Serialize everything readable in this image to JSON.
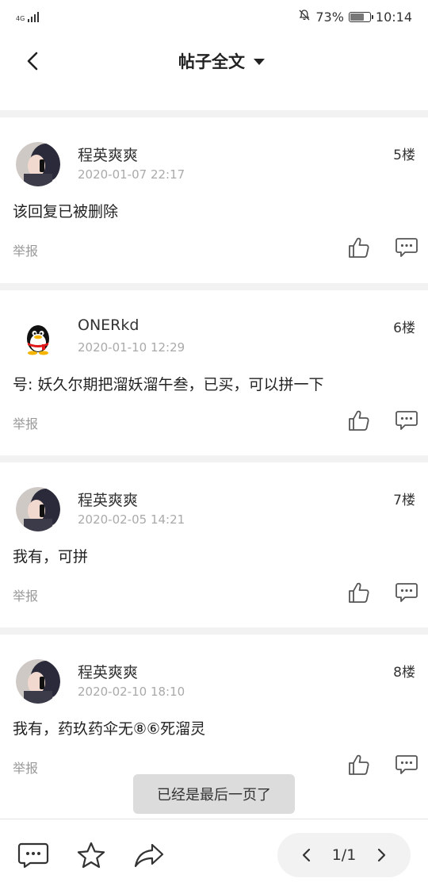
{
  "status_bar": {
    "network": "4G",
    "battery_percent": "73%",
    "battery_level": 0.73,
    "time": "10:14"
  },
  "header": {
    "title": "帖子全文",
    "back_icon": "back-arrow-icon",
    "dropdown_icon": "caret-down-icon"
  },
  "posts": [
    {
      "username": "程英爽爽",
      "datetime": "2020-01-07 22:17",
      "floor": "5楼",
      "content": "该回复已被删除",
      "report": "举报",
      "avatar": "photo-avatar"
    },
    {
      "username": "ONERkd",
      "datetime": "2020-01-10 12:29",
      "floor": "6楼",
      "content": "号: 妖久尔期把溜妖溜午叁，已买，可以拼一下",
      "report": "举报",
      "avatar": "qq-penguin-avatar"
    },
    {
      "username": "程英爽爽",
      "datetime": "2020-02-05 14:21",
      "floor": "7楼",
      "content": "我有，可拼",
      "report": "举报",
      "avatar": "photo-avatar"
    },
    {
      "username": "程英爽爽",
      "datetime": "2020-02-10 18:10",
      "floor": "8楼",
      "content": "我有，药玖药伞无⑧⑥死溜灵",
      "report": "举报",
      "avatar": "photo-avatar"
    }
  ],
  "toast": "已经是最后一页了",
  "bottom_bar": {
    "icons": [
      "comment-icon",
      "star-icon",
      "share-icon"
    ],
    "pager": "1/1"
  },
  "colors": {
    "text_primary": "#222222",
    "text_secondary": "#aaaaaa",
    "separator": "#f2f2f2",
    "toast_bg": "#dcdcdc"
  }
}
